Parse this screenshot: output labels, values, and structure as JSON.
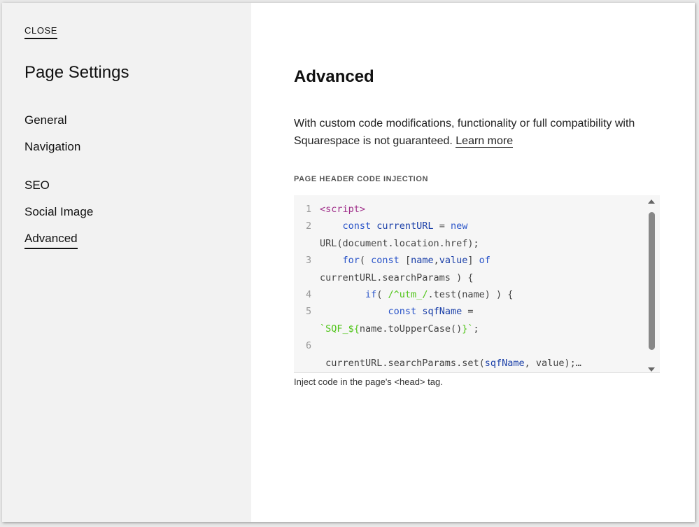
{
  "sidebar": {
    "close_label": "CLOSE",
    "title": "Page Settings",
    "items": [
      {
        "label": "General"
      },
      {
        "label": "Navigation"
      },
      {
        "label": "SEO"
      },
      {
        "label": "Social Image"
      },
      {
        "label": "Advanced"
      }
    ],
    "active_item": "Advanced"
  },
  "main": {
    "title": "Advanced",
    "description": "With custom code modifications, functionality or full compatibility with Squarespace is not guaranteed.",
    "learn_more_label": "Learn more",
    "section_label": "PAGE HEADER CODE INJECTION",
    "help_text": "Inject code in the page's <head> tag.",
    "code": {
      "line_numbers": [
        "1",
        "2",
        "3",
        "4",
        "5",
        "6"
      ],
      "lines": [
        {
          "num": "1",
          "segments": [
            {
              "t": "<script>",
              "c": "tag"
            }
          ]
        },
        {
          "num": "2",
          "segments": [
            {
              "t": "    const ",
              "c": "kw"
            },
            {
              "t": "currentURL",
              "c": "var"
            },
            {
              "t": " = ",
              "c": "plain"
            },
            {
              "t": "new",
              "c": "kw"
            }
          ]
        },
        {
          "num": "",
          "segments": [
            {
              "t": "URL(document.location.href);",
              "c": "plain"
            }
          ]
        },
        {
          "num": "3",
          "segments": [
            {
              "t": "    for",
              "c": "kw"
            },
            {
              "t": "( ",
              "c": "plain"
            },
            {
              "t": "const ",
              "c": "kw"
            },
            {
              "t": "[",
              "c": "plain"
            },
            {
              "t": "name",
              "c": "var"
            },
            {
              "t": ",",
              "c": "plain"
            },
            {
              "t": "value",
              "c": "var"
            },
            {
              "t": "] ",
              "c": "plain"
            },
            {
              "t": "of",
              "c": "kw"
            }
          ]
        },
        {
          "num": "",
          "segments": [
            {
              "t": "currentURL.searchParams ) {",
              "c": "plain"
            }
          ]
        },
        {
          "num": "4",
          "segments": [
            {
              "t": "        if",
              "c": "kw"
            },
            {
              "t": "( ",
              "c": "plain"
            },
            {
              "t": "/^utm_/",
              "c": "str"
            },
            {
              "t": ".test(name) ) {",
              "c": "plain"
            }
          ]
        },
        {
          "num": "5",
          "segments": [
            {
              "t": "            const ",
              "c": "kw"
            },
            {
              "t": "sqfName",
              "c": "var"
            },
            {
              "t": " =",
              "c": "plain"
            }
          ]
        },
        {
          "num": "",
          "segments": [
            {
              "t": "`SQF_${",
              "c": "str"
            },
            {
              "t": "name.toUpperCase()",
              "c": "plain"
            },
            {
              "t": "}`",
              "c": "str"
            },
            {
              "t": ";",
              "c": "plain"
            }
          ]
        },
        {
          "num": "6",
          "segments": []
        },
        {
          "num": "",
          "segments": [
            {
              "t": " currentURL.searchParams.set(",
              "c": "plain"
            },
            {
              "t": "sqfName",
              "c": "var"
            },
            {
              "t": ", value);…",
              "c": "plain"
            }
          ]
        }
      ]
    }
  },
  "icons": {
    "scroll_up": "scroll-up-arrow-icon",
    "scroll_down": "scroll-down-arrow-icon"
  },
  "colors": {
    "sidebar_bg": "#f2f2f2",
    "code_bg": "#f6f6f6",
    "tag": "#a0308a",
    "keyword": "#2b55c9",
    "variable": "#1a3fa8",
    "string": "#4fc417"
  }
}
